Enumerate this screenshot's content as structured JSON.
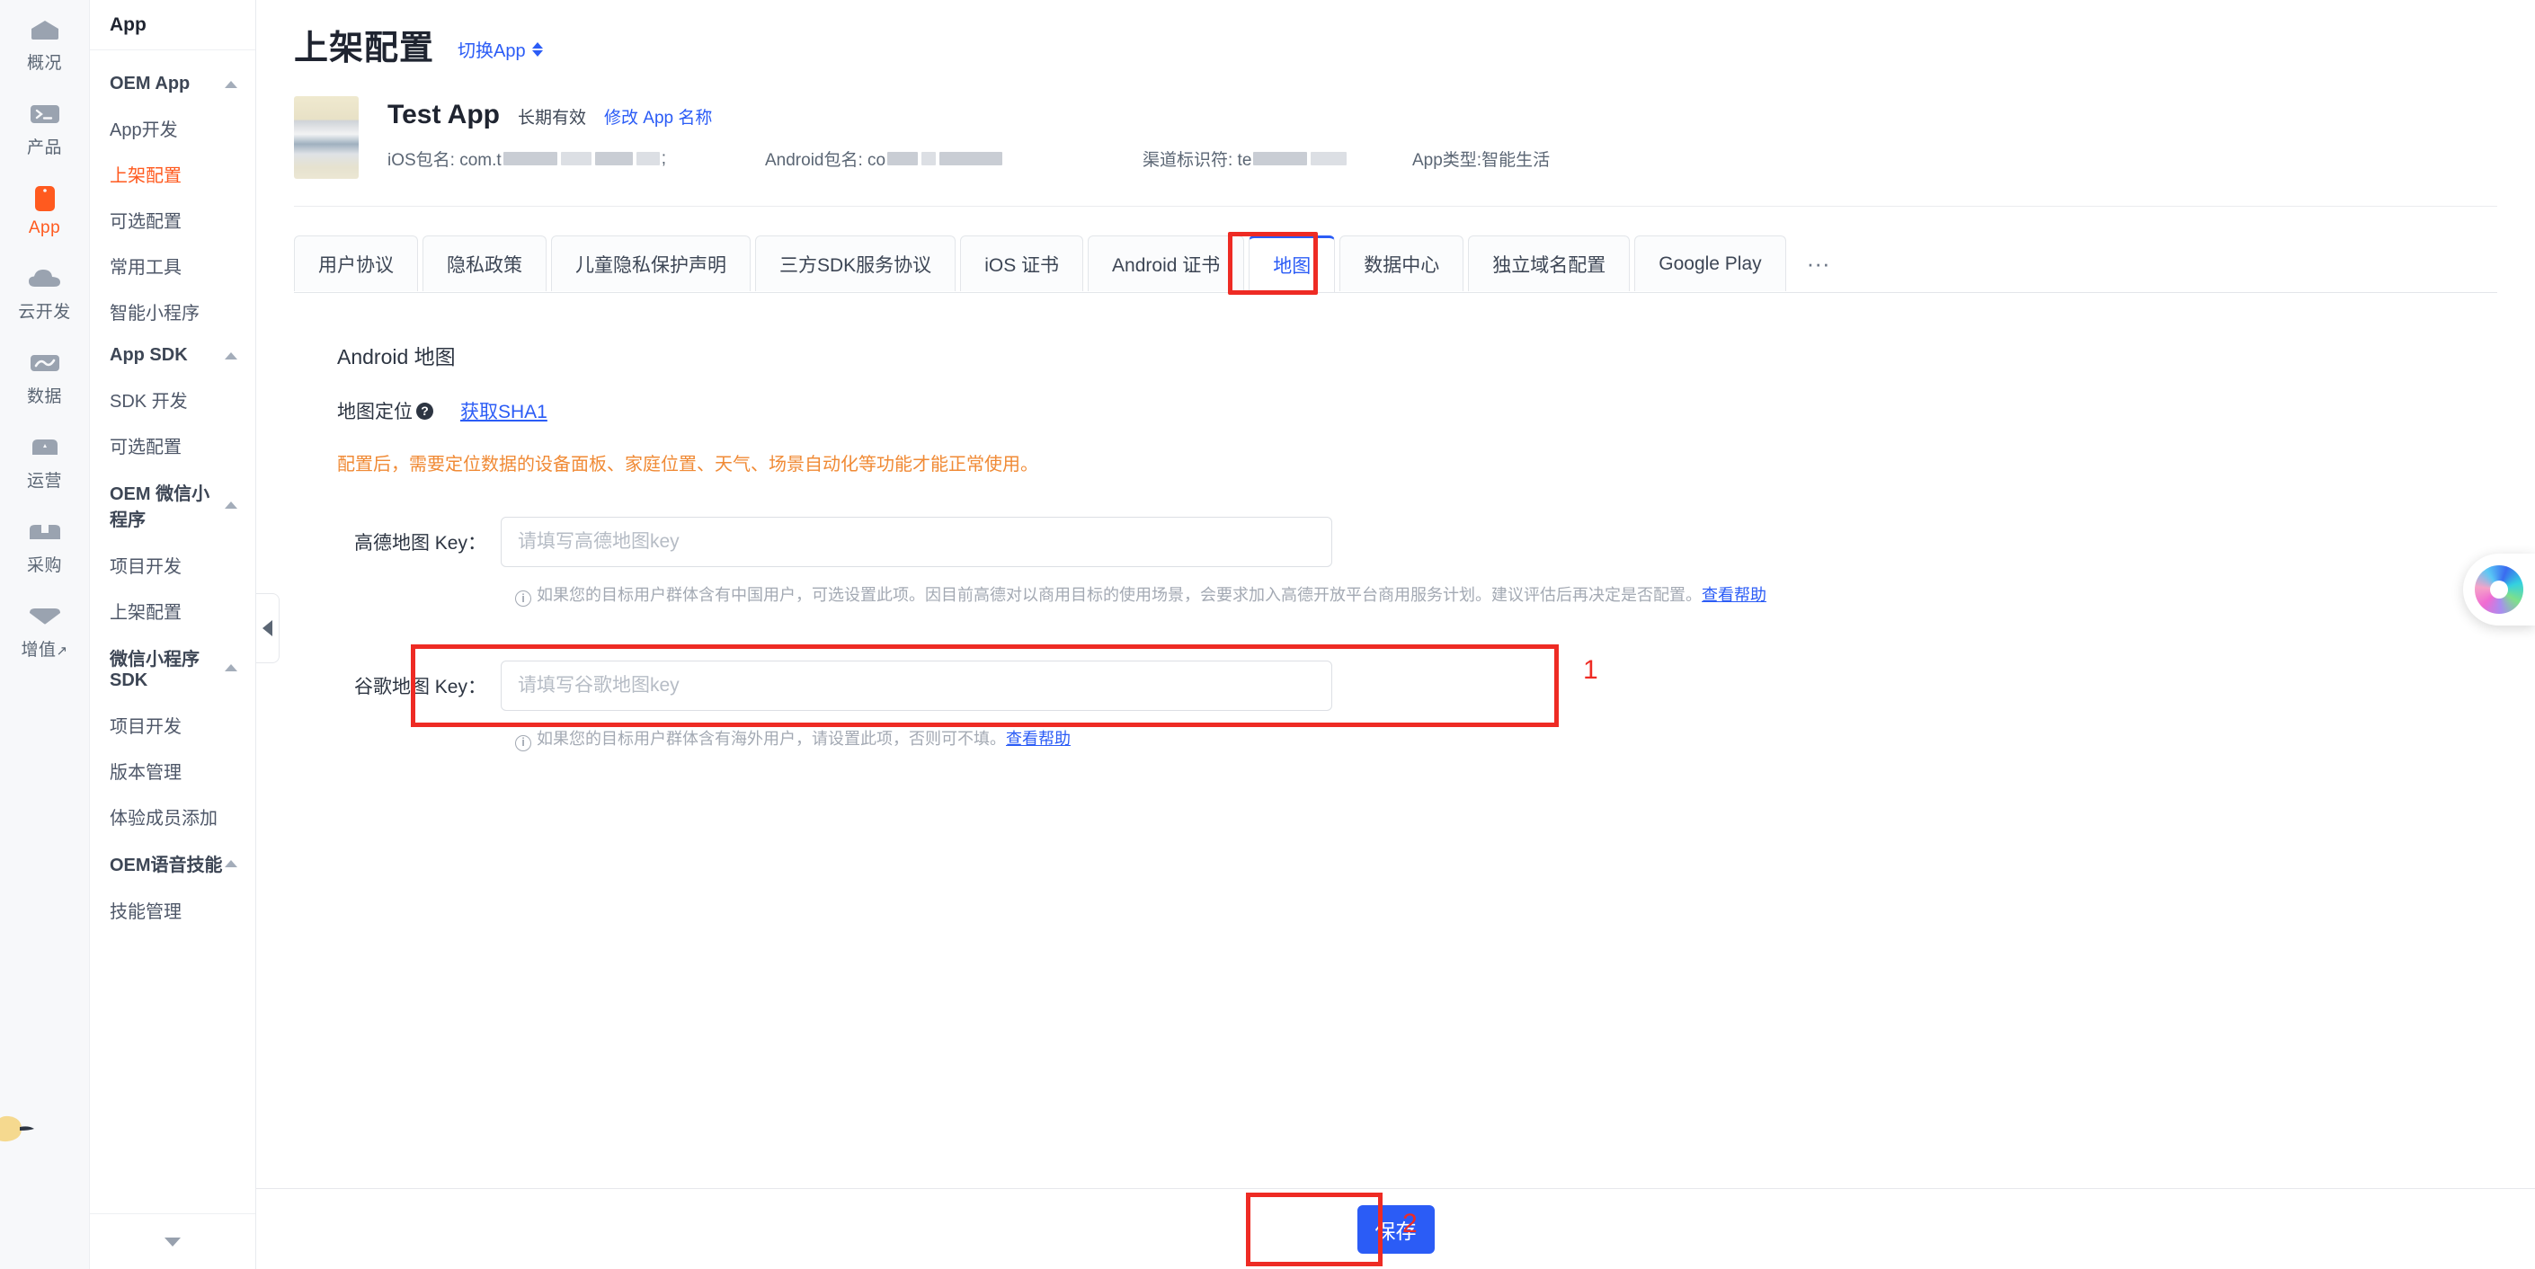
{
  "rail": {
    "items": [
      {
        "label": "概况",
        "icon": "home-icon",
        "active": false
      },
      {
        "label": "产品",
        "icon": "terminal-icon",
        "active": false
      },
      {
        "label": "App",
        "icon": "phone-icon",
        "active": true
      },
      {
        "label": "云开发",
        "icon": "cloud-icon",
        "active": false
      },
      {
        "label": "数据",
        "icon": "chart-icon",
        "active": false
      },
      {
        "label": "运营",
        "icon": "megaphone-icon",
        "active": false
      },
      {
        "label": "采购",
        "icon": "box-icon",
        "active": false
      },
      {
        "label": "增值",
        "icon": "heart-icon",
        "active": false,
        "suffix": "↗"
      }
    ]
  },
  "nav": {
    "header": "App",
    "groups": [
      {
        "title": "OEM App",
        "items": [
          {
            "label": "App开发",
            "active": false
          },
          {
            "label": "上架配置",
            "active": true
          },
          {
            "label": "可选配置",
            "active": false
          },
          {
            "label": "常用工具",
            "active": false
          },
          {
            "label": "智能小程序",
            "active": false
          }
        ]
      },
      {
        "title": "App SDK",
        "items": [
          {
            "label": "SDK 开发",
            "active": false
          },
          {
            "label": "可选配置",
            "active": false
          }
        ]
      },
      {
        "title": "OEM 微信小程序",
        "items": [
          {
            "label": "项目开发",
            "active": false
          },
          {
            "label": "上架配置",
            "active": false
          }
        ]
      },
      {
        "title": "微信小程序 SDK",
        "items": [
          {
            "label": "项目开发",
            "active": false
          },
          {
            "label": "版本管理",
            "active": false
          },
          {
            "label": "体验成员添加",
            "active": false
          }
        ]
      },
      {
        "title": "OEM语音技能",
        "items": [
          {
            "label": "技能管理",
            "active": false
          }
        ]
      }
    ]
  },
  "page": {
    "title": "上架配置",
    "switch_app": "切换App"
  },
  "app_info": {
    "name": "Test App",
    "validity": "长期有效",
    "rename_link": "修改 App 名称",
    "ios_package_label": "iOS包名: com.t",
    "ios_package_suffix": ";",
    "android_package_label": "Android包名: co",
    "channel_label": "渠道标识符: te",
    "app_type": "App类型:智能生活"
  },
  "tabs": {
    "items": [
      {
        "label": "用户协议",
        "active": false
      },
      {
        "label": "隐私政策",
        "active": false
      },
      {
        "label": "儿童隐私保护声明",
        "active": false
      },
      {
        "label": "三方SDK服务协议",
        "active": false
      },
      {
        "label": "iOS 证书",
        "active": false
      },
      {
        "label": "Android 证书",
        "active": false
      },
      {
        "label": "地图",
        "active": true
      },
      {
        "label": "数据中心",
        "active": false
      },
      {
        "label": "独立域名配置",
        "active": false
      },
      {
        "label": "Google Play",
        "active": false
      }
    ],
    "more": "···"
  },
  "form": {
    "section_title": "Android 地图",
    "locate_label": "地图定位",
    "sha_link": "获取SHA1",
    "warning": "配置后，需要定位数据的设备面板、家庭位置、天气、场景自动化等功能才能正常使用。",
    "amap": {
      "label": "高德地图 Key：",
      "placeholder": "请填写高德地图key",
      "value": "",
      "hint": "如果您的目标用户群体含有中国用户，可选设置此项。因目前高德对以商用目标的使用场景，会要求加入高德开放平台商用服务计划。建议评估后再决定是否配置。",
      "hint_link": "查看帮助"
    },
    "gmap": {
      "label": "谷歌地图 Key：",
      "placeholder": "请填写谷歌地图key",
      "value": "",
      "hint": "如果您的目标用户群体含有海外用户，请设置此项，否则可不填。",
      "hint_link": "查看帮助"
    }
  },
  "footer": {
    "save_label": "保存"
  },
  "annotations": {
    "step1": "1",
    "step2": "2",
    "color": "#ee2b24"
  }
}
